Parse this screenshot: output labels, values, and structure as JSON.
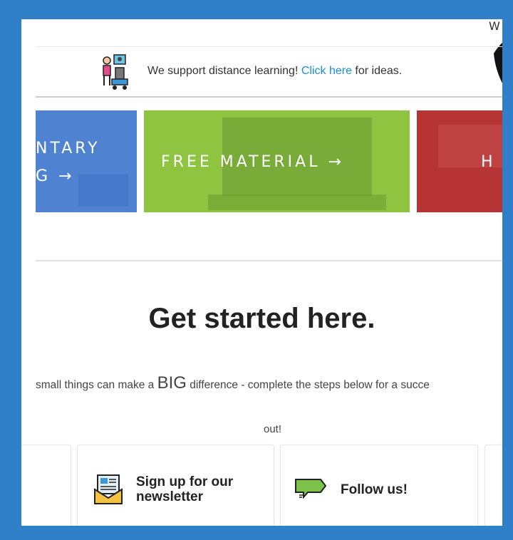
{
  "corner": {
    "letter": "W"
  },
  "banner": {
    "text_before": "We support distance learning! ",
    "link": "Click here",
    "text_after": " for ideas."
  },
  "tiles": {
    "blue": {
      "line1": "NTARY",
      "line2": "G →"
    },
    "green": {
      "label": "FREE MATERIAL →"
    },
    "red": {
      "label": "H"
    }
  },
  "headline": "Get started here.",
  "tagline": {
    "before": "small things can make a ",
    "big": "BIG",
    "after": " difference - complete the steps below for a succe",
    "line2": "out!"
  },
  "cards": [
    {
      "title": "Sign up for our newsletter"
    },
    {
      "title": "Follow us!"
    }
  ],
  "colors": {
    "frame": "#2f80c9",
    "link": "#1a8fd6",
    "tile_blue": "#4a7fd0",
    "tile_green": "#8fc440",
    "tile_red": "#b63434"
  },
  "icons": [
    "student-at-computer-icon",
    "newsletter-envelope-icon",
    "follow-sign-icon"
  ]
}
